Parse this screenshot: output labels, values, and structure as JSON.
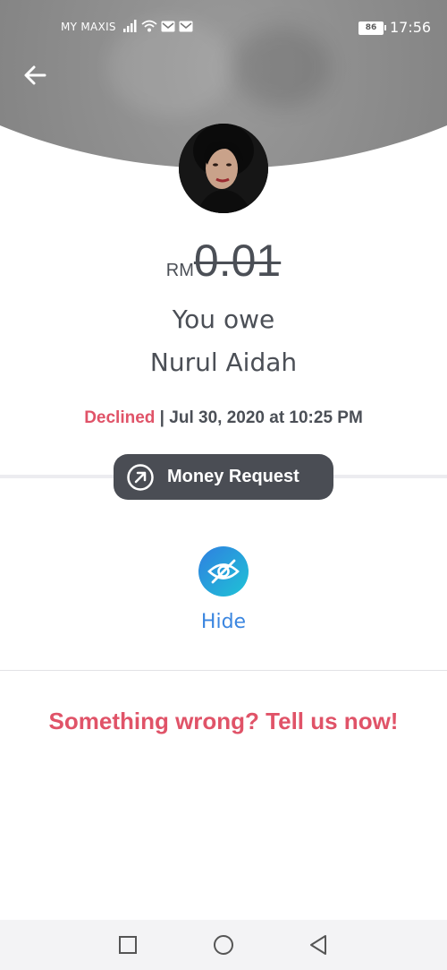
{
  "status_bar": {
    "carrier": "MY MAXIS",
    "battery": "86",
    "time": "17:56"
  },
  "transaction": {
    "currency": "RM",
    "amount": "0.01",
    "line1": "You owe",
    "line2": "Nurul Aidah",
    "status": "Declined",
    "separator": "|",
    "datetime": "Jul 30, 2020 at 10:25 PM",
    "type_label": "Money Request"
  },
  "actions": {
    "hide_label": "Hide"
  },
  "help": {
    "link_text": "Something wrong? Tell us now!"
  },
  "colors": {
    "declined": "#e05368",
    "accent_blue": "#3b86e0",
    "pill_bg": "#4a4d54"
  }
}
